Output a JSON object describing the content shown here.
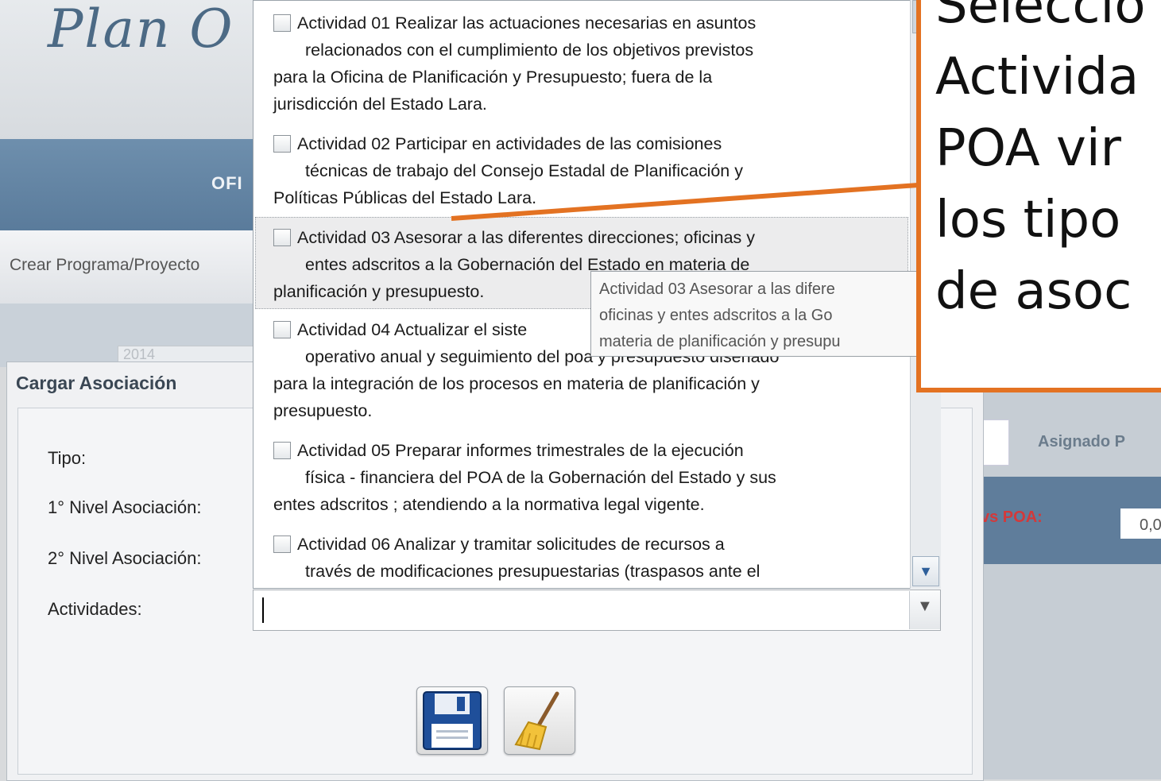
{
  "app": {
    "logo_text": "Plan O",
    "banner_text": "OFI",
    "menu_item": "Crear Programa/Proyecto",
    "year": "2014"
  },
  "right_panel": {
    "asignado_label": "Asignado P",
    "vs_poa_label": "vs POA:",
    "poa_value": "0,0"
  },
  "dialog": {
    "title": "Cargar Asociación",
    "labels": {
      "tipo": "Tipo:",
      "nivel1": "1° Nivel Asociación:",
      "nivel2": "2° Nivel Asociación:",
      "actividades": "Actividades:"
    },
    "actividades_value": "",
    "buttons": {
      "save_icon": "floppy-disk-icon",
      "clear_icon": "broom-icon"
    }
  },
  "dropdown": {
    "items": [
      {
        "line1": "Actividad 01 Realizar las actuaciones necesarias en asuntos",
        "line2": "relacionados con el cumplimiento de los objetivos previstos",
        "line3": "para la Oficina de Planificación y Presupuesto; fuera de la",
        "line4": "jurisdicción del Estado Lara."
      },
      {
        "line1": "Actividad 02 Participar en actividades de las comisiones",
        "line2": "técnicas de trabajo del Consejo Estadal de Planificación y",
        "line3": "Políticas Públicas del Estado Lara."
      },
      {
        "line1": "Actividad 03 Asesorar a las diferentes direcciones; oficinas y",
        "line2": "entes adscritos a  la Gobernación del Estado en materia de",
        "line3": "planificación y presupuesto."
      },
      {
        "line1": "Actividad 04 Actualizar el siste",
        "line2": "operativo anual y seguimiento del poa y presupuesto diseñado",
        "line3": "para la integración de los procesos en materia de planificación y",
        "line4": "presupuesto."
      },
      {
        "line1": "Actividad 05 Preparar informes trimestrales de la ejecución",
        "line2": "física - financiera del POA de la Gobernación del Estado y sus",
        "line3": "entes adscritos ; atendiendo a la normativa legal vigente."
      },
      {
        "line1": "Actividad 06 Analizar y tramitar solicitudes de recursos a",
        "line2": "través de modificaciones presupuestarias (traspasos ante el"
      }
    ],
    "tooltip": {
      "line1": "Actividad 03 Asesorar a las difere",
      "line2": "oficinas y entes adscritos a la Go",
      "line3": "materia de planificación y presupu"
    }
  },
  "callout": {
    "line1": "Seleccio",
    "line2": "Activida",
    "line3": "POA vir",
    "line4": "los tipo",
    "line5": "de asoc"
  },
  "colors": {
    "callout_border": "#e37222",
    "header_blue": "#5a7b9b",
    "alert_red": "#d3393a"
  }
}
